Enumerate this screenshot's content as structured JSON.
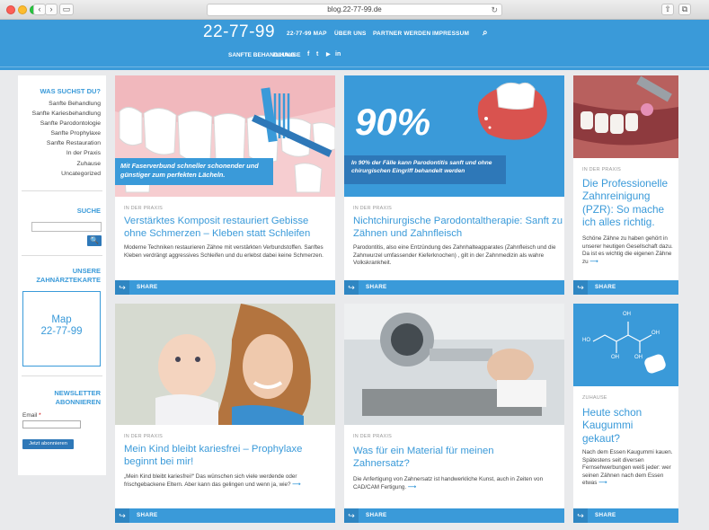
{
  "browser": {
    "url": "blog.22-77-99.de",
    "back": "‹",
    "forward": "›",
    "sidebar_toggle": "▭",
    "reload": "↻",
    "share": "⇧",
    "tabs": "⧉"
  },
  "header": {
    "logo": "22-77-99",
    "nav": [
      "22-77-99 MAP",
      "ÜBER UNS",
      "PARTNER WERDEN",
      "IMPRESSUM"
    ],
    "search_icon": "⌕",
    "subnav": [
      "SANFTE BEHANDLUNG",
      "ZUHAUSE"
    ],
    "social": [
      "f",
      "t",
      "▶",
      "in"
    ]
  },
  "sidebar": {
    "search_title": "WAS SUCHST DU?",
    "categories": [
      "Sanfte Behandlung",
      "Sanfte Kariesbehandlung",
      "Sanfte Parodontologie",
      "Sanfte Prophylaxe",
      "Sanfte Restauration",
      "In der Praxis",
      "Zuhause",
      "Uncategorized"
    ],
    "suche_title": "SUCHE",
    "search_button": "🔍",
    "map_title": "UNSERE ZAHNÄRZTEKARTE",
    "map_link_1": "Map",
    "map_link_2": "22-77-99",
    "newsletter_title_1": "NEWSLETTER",
    "newsletter_title_2": "ABONNIEREN",
    "email_label": "Email",
    "email_required": "*",
    "subscribe_button": "Jetzt abonnieren"
  },
  "share_label": "SHARE",
  "share_icon": "↪",
  "cards": [
    {
      "category": "IN DER PRAXIS",
      "title": "Verstärktes Komposit restauriert Gebisse ohne Schmerzen – Kleben statt Schleifen",
      "text": "Moderne Techniken restaurieren Zähne mit verstärkten Verbundstoffen. Sanftes Kleben verdrängt aggressives Schleifen und du erlebst dabei keine Schmerzen.",
      "banner": "Mit Faserverbund schneller schonender und günstiger zum perfekten Lächeln."
    },
    {
      "category": "IN DER PRAXIS",
      "title": "Nichtchirurgische Parodontaltherapie: Sanft zu Zähnen und Zahnfleisch",
      "text": "Parodontitis, also eine Entzündung des Zahnhalteapparates (Zahnfleisch und die Zahnwurzel umfassender Kieferknochen) , gilt in der Zahnmedizin als wahre Volkskrankheit.",
      "big_number": "90%",
      "banner": "In 90% der Fälle kann Parodontitis sanft und ohne chirurgischen Eingriff behandelt werden"
    },
    {
      "category": "IN DER PRAXIS",
      "title": "Die Professionelle Zahnreinigung (PZR): So mache ich alles richtig.",
      "text": "Schöne Zähne zu haben gehört in unserer heutigen Gesellschaft dazu. Da ist es wichtig die eigenen Zähne zu"
    },
    {
      "category": "IN DER PRAXIS",
      "title": "Mein Kind bleibt kariesfrei – Prophylaxe beginnt bei mir!",
      "text": "„Mein Kind bleibt kariesfrei!“ Das wünschen sich viele werdende oder frischgebackene Eltern. Aber kann das gelingen und wenn ja, wie?"
    },
    {
      "category": "IN DER PRAXIS",
      "title": "Was für ein Material für meinen Zahnersatz?",
      "text": "Die Anfertigung von Zahnersatz ist handwerkliche Kunst, auch in Zeiten von CAD/CAM Fertigung."
    },
    {
      "category": "ZUHAUSE",
      "title": "Heute schon Kaugummi gekaut?",
      "text": "Nach dem Essen Kaugummi kauen. Spätestens seit diversen Fernsehwerbungen weiß jeder: wer seinen Zähnen nach dem Essen etwas",
      "molecule_labels": [
        "OH",
        "OH",
        "HO",
        "OH",
        "OH"
      ]
    }
  ],
  "more_arrow": "⟶"
}
